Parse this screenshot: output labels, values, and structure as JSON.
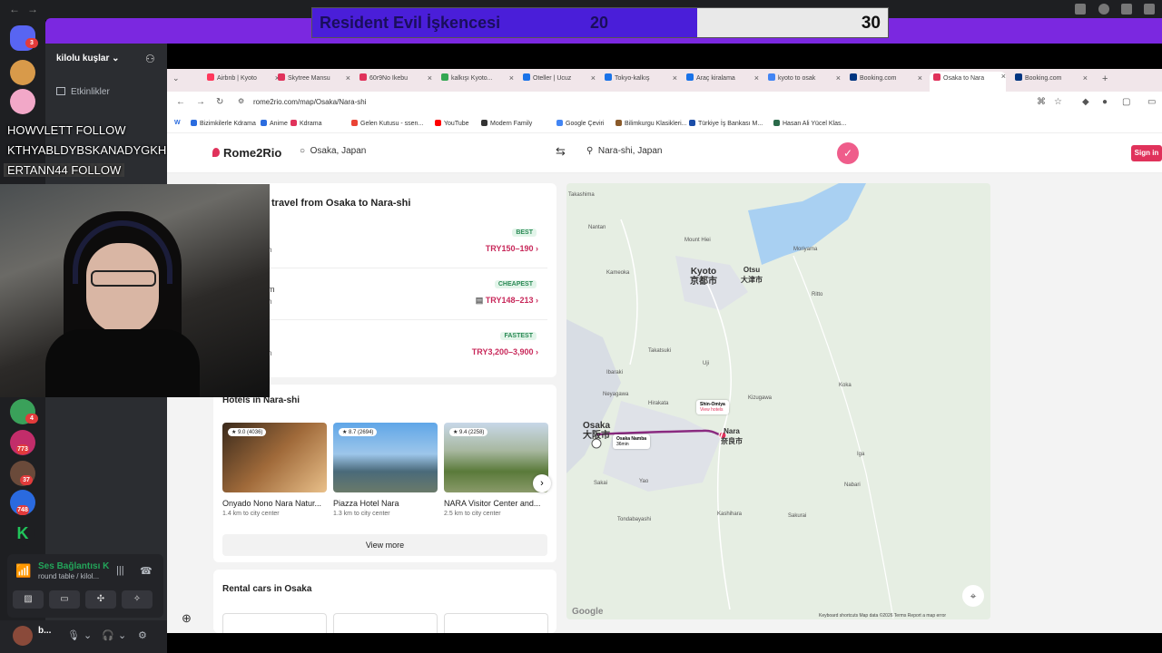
{
  "poll": {
    "title": "Resident Evil İşkencesi",
    "left_value": "20",
    "right_value": "30"
  },
  "discord": {
    "server_name": "kilolu kuşlar",
    "events_label": "Etkinlikler",
    "badges": [
      "3",
      "4",
      "773",
      "37",
      "748"
    ],
    "voice": {
      "status": "Ses Bağlantısı K",
      "channel": "round table / kilol..."
    },
    "user": {
      "name": "b..."
    }
  },
  "overlay": {
    "follow1": "HOWVLETT FOLLOW",
    "follow2": "KTHYABLDYBSKANADYGKHNAKSN FOLLOW",
    "follow3": "ERTANN44 FOLLOW"
  },
  "browser": {
    "tabs": [
      {
        "label": "Airbnb | Kyoto",
        "color": "#ff385c"
      },
      {
        "label": "Skytree Mansu",
        "color": "#e0325b"
      },
      {
        "label": "60r9No Ikebu",
        "color": "#e0325b"
      },
      {
        "label": "kalkışı Kyoto...",
        "color": "#34a853"
      },
      {
        "label": "Oteller | Ucuz",
        "color": "#1a73e8"
      },
      {
        "label": "Tokyo-kalkış",
        "color": "#1a73e8"
      },
      {
        "label": "Araç kiralama",
        "color": "#1a73e8"
      },
      {
        "label": "kyoto to osak",
        "color": "#4285f4"
      },
      {
        "label": "Booking.com",
        "color": "#003580"
      },
      {
        "label": "Osaka to Nara",
        "color": "#e0325b"
      },
      {
        "label": "Booking.com",
        "color": "#003580"
      }
    ],
    "url": "rome2rio.com/map/Osaka/Nara-shi",
    "bookmarks": [
      {
        "label": "Bizimkilerle Kdrama",
        "color": "#2b6cdf"
      },
      {
        "label": "Anime",
        "color": "#2b6cdf"
      },
      {
        "label": "Kdrama",
        "color": "#e0325b"
      },
      {
        "label": "Gelen Kutusu - ssen...",
        "color": "#ea4335"
      },
      {
        "label": "YouTube",
        "color": "#ff0000"
      },
      {
        "label": "Modern Family",
        "color": "#333333"
      },
      {
        "label": "Google Çeviri",
        "color": "#4285f4"
      },
      {
        "label": "Bilimkurgu Klasikleri...",
        "color": "#8a5a2a"
      },
      {
        "label": "Türkiye İş Bankası M...",
        "color": "#1b4da8"
      },
      {
        "label": "Hasan Ali Yücel Klas...",
        "color": "#2a6a4a"
      }
    ]
  },
  "page": {
    "logo": "Rome2Rio",
    "from": "Osaka, Japan",
    "to": "Nara-shi, Japan",
    "sign_in": "Sign in",
    "routes_title": "travel from Osaka to Nara-shi",
    "routes": [
      {
        "label": "BEST",
        "price": "TRY150–190",
        "mode": "",
        "sub": "h"
      },
      {
        "label": "CHEAPEST",
        "price": "TRY148–213",
        "mode": "m",
        "sub": "h"
      },
      {
        "label": "FASTEST",
        "price": "TRY3,200–3,900",
        "mode": "",
        "sub": "n"
      }
    ],
    "hotels_title": "Hotels in Nara-shi",
    "hotels": [
      {
        "rating": "★ 9.0 (4036)",
        "name": "Onyado Nono Nara Natur...",
        "dist": "1.4 km to city center"
      },
      {
        "rating": "★ 8.7 (2694)",
        "name": "Piazza Hotel Nara",
        "dist": "1.3 km to city center"
      },
      {
        "rating": "★ 9.4 (2258)",
        "name": "NARA Visitor Center and...",
        "dist": "2.5 km to city center"
      }
    ],
    "view_more": "View more",
    "rental_title": "Rental cars in Osaka"
  },
  "map": {
    "cities": {
      "kyoto": "Kyoto",
      "kyoto_jp": "京都市",
      "osaka": "Osaka",
      "osaka_jp": "大阪市",
      "nara": "Nara",
      "nara_jp": "奈良市",
      "otsu": "Otsu",
      "otsu_jp": "大津市"
    },
    "labels": [
      "Takashima",
      "Nantan",
      "Kameoka",
      "Ibaraki",
      "Takatsuki",
      "Hirakata",
      "Neyagawa",
      "Yao",
      "Sakai",
      "Tondabayashi",
      "Kashihara",
      "Sakurai",
      "Uji",
      "Kizugawa",
      "Iga",
      "Nabari",
      "Koka",
      "Mount Hiei",
      "Moriyama",
      "Ritto"
    ],
    "station": "Shin-Omiya",
    "view_hotels": "View hotels",
    "osaka_namba": "Osaka Namba",
    "duration": "36min",
    "footer": "Keyboard shortcuts   Map data ©2026   Terms   Report a map error",
    "google": "Google",
    "route_color": "#8a2a80"
  }
}
